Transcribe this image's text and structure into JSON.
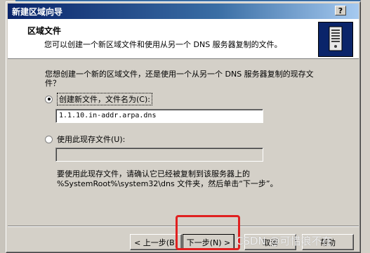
{
  "dialog": {
    "title": "新建区域向导",
    "help_button": "?"
  },
  "header": {
    "title": "区域文件",
    "subtitle": "您可以创建一个新区域文件和使用从另一个 DNS 服务器复制的文件。",
    "icon": "server-icon"
  },
  "question": "您想创建一个新的区域文件，还是使用一个从另一个 DNS 服务器复制的现存文件？",
  "options": {
    "create_new": {
      "label": "创建新文件，文件名为(C):",
      "selected": true
    },
    "filename_value": "1.1.10.in-addr.arpa.dns",
    "use_existing": {
      "label": "使用此现存文件(U):",
      "selected": false
    },
    "existing_value": ""
  },
  "note": "要使用此现存文件，请确认它已经被复制到该服务器上的 %SystemRoot%\\system32\\dns 文件夹，然后单击“下一步”。",
  "buttons": {
    "back": "< 上一步(B)",
    "next": "下一步(N) >",
    "cancel": "取消",
    "help": "帮助"
  },
  "watermark": "CSDN @可惜浪不在",
  "colors": {
    "title_bar": "#0a246a",
    "highlight": "#e02020",
    "dialog_bg": "#d4d0c8"
  }
}
